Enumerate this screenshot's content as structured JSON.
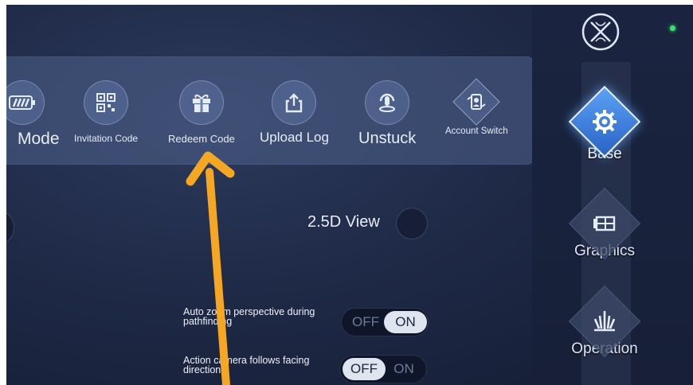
{
  "toolbar": {
    "items": [
      {
        "label": "Mode",
        "icon": "battery-icon"
      },
      {
        "label": "Invitation Code",
        "icon": "qr-code-icon"
      },
      {
        "label": "Redeem Code",
        "icon": "gift-icon"
      },
      {
        "label": "Upload Log",
        "icon": "upload-icon"
      },
      {
        "label": "Unstuck",
        "icon": "unstuck-icon"
      },
      {
        "label": "Account Switch",
        "icon": "account-switch-icon"
      }
    ]
  },
  "view": {
    "label": "2.5D View"
  },
  "settings": [
    {
      "text": "Auto zoom perspective during pathfinding",
      "off": "OFF",
      "on": "ON",
      "value": "ON"
    },
    {
      "text": "Action camera follows facing direction",
      "off": "OFF",
      "on": "ON",
      "value": "OFF"
    }
  ],
  "sidebar": {
    "items": [
      {
        "label": "Base",
        "icon": "gear-icon",
        "active": true
      },
      {
        "label": "Graphics",
        "icon": "graphics-icon",
        "active": false
      },
      {
        "label": "Operation",
        "icon": "operation-icon",
        "active": false
      }
    ]
  },
  "colors": {
    "accent": "#3f83e0",
    "annotation": "#f5a623",
    "status": "#39e26a"
  }
}
